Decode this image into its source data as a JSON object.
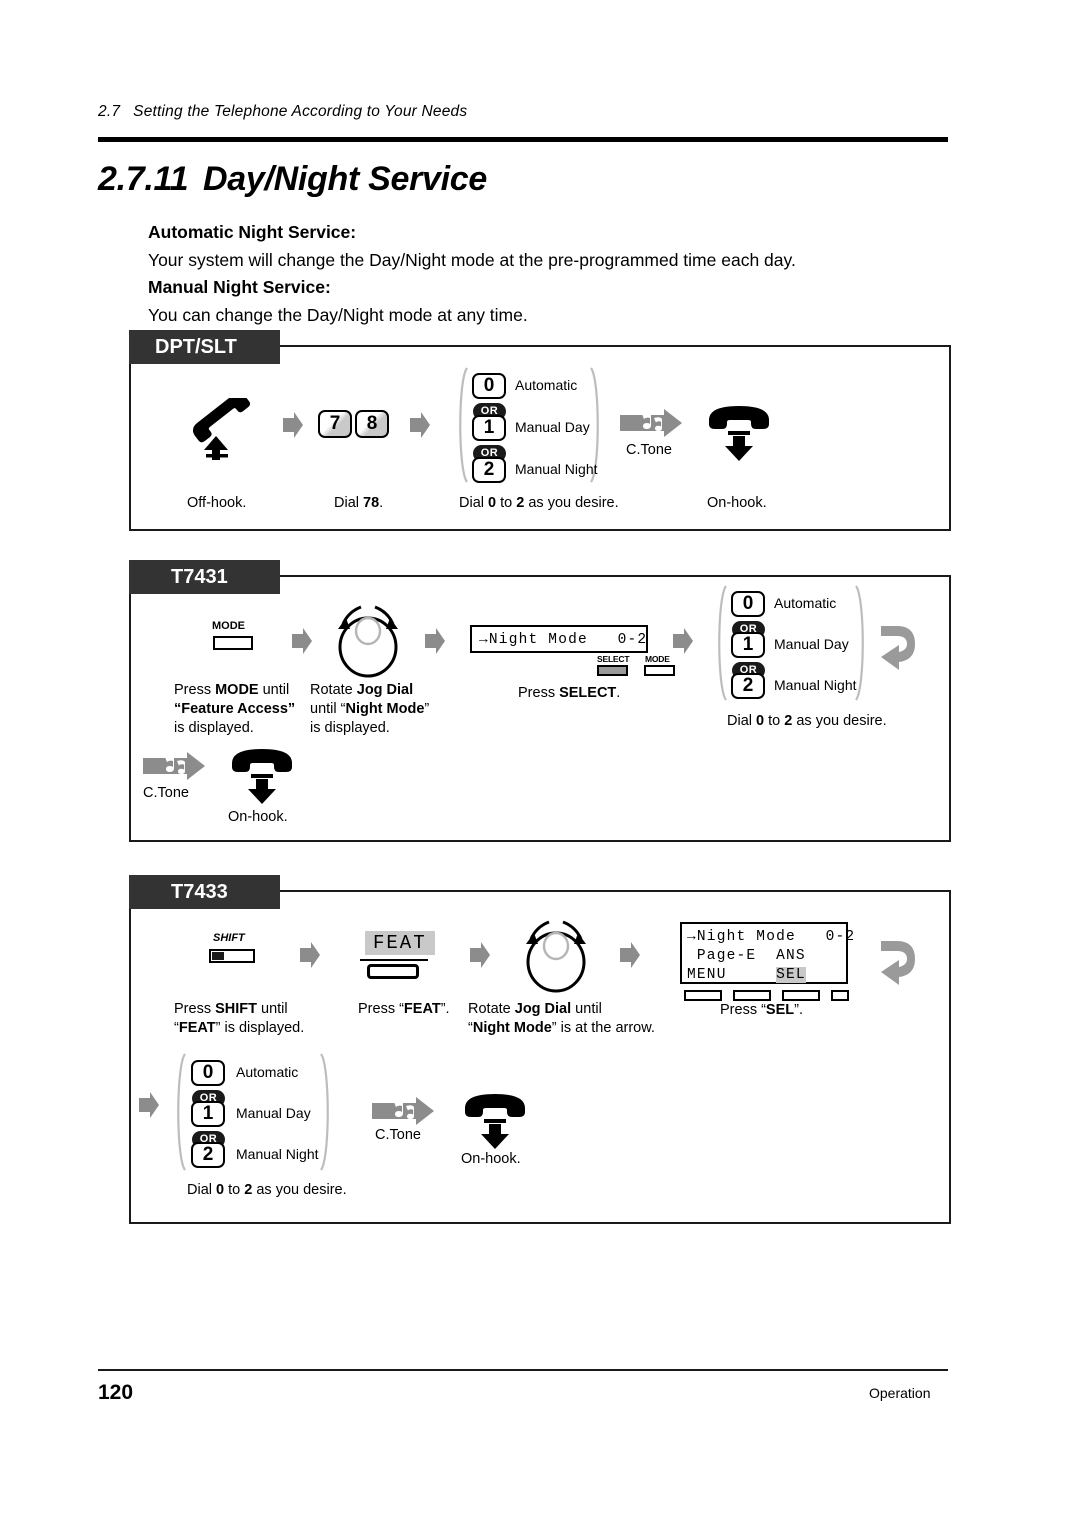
{
  "header": {
    "section_number": "2.7",
    "section_title": "Setting the Telephone According to Your Needs"
  },
  "title": {
    "number": "2.7.11",
    "text": "Day/Night Service"
  },
  "intro": {
    "auto_heading": "Automatic Night Service:",
    "auto_body": "Your system will change the Day/Night mode at the pre-programmed time each day.",
    "manual_heading": "Manual Night Service:",
    "manual_body": "You can change the Day/Night mode at any time."
  },
  "options": {
    "automatic": {
      "key": "0",
      "label": "Automatic"
    },
    "manual_day": {
      "key": "1",
      "label": "Manual Day"
    },
    "manual_night": {
      "key": "2",
      "label": "Manual Night"
    },
    "or": "OR",
    "dial_caption_pre": "Dial ",
    "dial_caption_0": "0",
    "dial_caption_mid": " to ",
    "dial_caption_2": "2",
    "dial_caption_post": " as you desire."
  },
  "panels": {
    "dptslt": {
      "tab": "DPT/SLT",
      "offhook_caption": "Off-hook.",
      "dial_caption_pre": "Dial ",
      "dial_caption_num": "78",
      "dial_caption_post": ".",
      "key7": "7",
      "key8": "8",
      "ctone": "C.Tone",
      "onhook_caption": "On-hook."
    },
    "t7431": {
      "tab": "T7431",
      "mode_button_label": "MODE",
      "step1_line1_pre": "Press ",
      "step1_line1_bold": "MODE",
      "step1_line1_post": " until",
      "step1_line2": "“Feature Access”",
      "step1_line3": "is displayed.",
      "step2_line1_pre": "Rotate ",
      "step2_line1_bold": "Jog Dial",
      "step2_line2_pre": "until “",
      "step2_line2_bold": "Night Mode",
      "step2_line2_post": "”",
      "step2_line3": "is displayed.",
      "lcd_line": "→Night Mode   0-2",
      "softkey_select": "SELECT",
      "softkey_mode": "MODE",
      "step3_pre": "Press ",
      "step3_bold": "SELECT",
      "step3_post": ".",
      "ctone": "C.Tone",
      "onhook_caption": "On-hook."
    },
    "t7433": {
      "tab": "T7433",
      "shift_button_label": "SHIFT",
      "step1_line1_pre": "Press ",
      "step1_line1_bold": "SHIFT",
      "step1_line1_post": " until",
      "step1_line2_pre": "“",
      "step1_line2_bold": "FEAT",
      "step1_line2_post": "” is displayed.",
      "feat_key_label": "FEAT",
      "step2_pre": "Press “",
      "step2_bold": "FEAT",
      "step2_post": "”.",
      "step3_line1_pre": "Rotate ",
      "step3_line1_bold": "Jog Dial",
      "step3_line1_post": " until",
      "step3_line2_pre": "“",
      "step3_line2_bold": "Night Mode",
      "step3_line2_post": "” is at the arrow.",
      "lcd_line1": "→Night Mode   0-2",
      "lcd_line2": " Page-E  ANS",
      "lcd_line3_left": "MENU",
      "lcd_line3_right": "SEL",
      "step4_pre": "Press “",
      "step4_bold": "SEL",
      "step4_post": "”.",
      "ctone": "C.Tone",
      "onhook_caption": "On-hook."
    }
  },
  "footer": {
    "page_number": "120",
    "right_label": "Operation"
  },
  "colors": {
    "tab_bg": "#333333",
    "arrow_gray": "#8c8c8c",
    "key_shade": "#c9c9c9",
    "softkey_fill": "#9a9a9a",
    "rule": "#000000"
  }
}
